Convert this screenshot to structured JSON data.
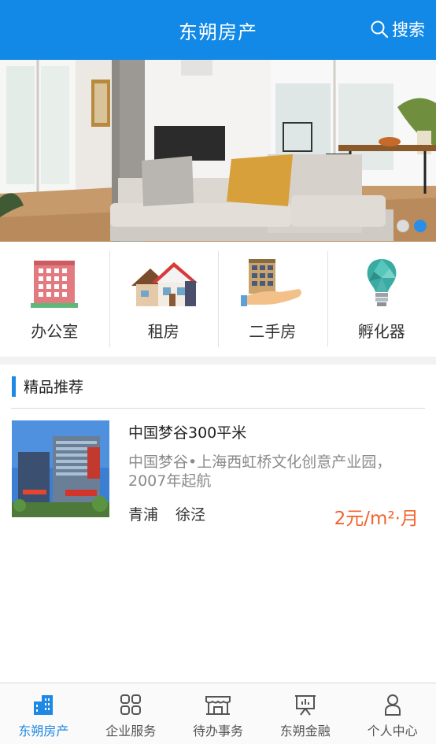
{
  "header": {
    "title": "东朔房产",
    "search_label": "搜索"
  },
  "banner": {
    "slide_count": 2,
    "active_slide": 2
  },
  "categories": [
    {
      "label": "办公室",
      "icon": "office-building-icon"
    },
    {
      "label": "租房",
      "icon": "house-icon"
    },
    {
      "label": "二手房",
      "icon": "second-hand-house-icon"
    },
    {
      "label": "孵化器",
      "icon": "lightbulb-icon"
    }
  ],
  "section": {
    "title": "精品推荐"
  },
  "listings": [
    {
      "name": "中国梦谷300平米",
      "description": "中国梦谷•上海西虹桥文化创意产业园，2007年起航",
      "district": "青浦",
      "town": "徐泾",
      "price": "2元/m²·月"
    }
  ],
  "tabbar": [
    {
      "label": "东朔房产",
      "icon": "buildings-icon",
      "active": true
    },
    {
      "label": "企业服务",
      "icon": "grid-icon",
      "active": false
    },
    {
      "label": "待办事务",
      "icon": "store-icon",
      "active": false
    },
    {
      "label": "东朔金融",
      "icon": "presentation-icon",
      "active": false
    },
    {
      "label": "个人中心",
      "icon": "person-icon",
      "active": false
    }
  ],
  "colors": {
    "primary": "#1289e7",
    "price": "#f0642c",
    "active_tab": "#1e88e5"
  }
}
